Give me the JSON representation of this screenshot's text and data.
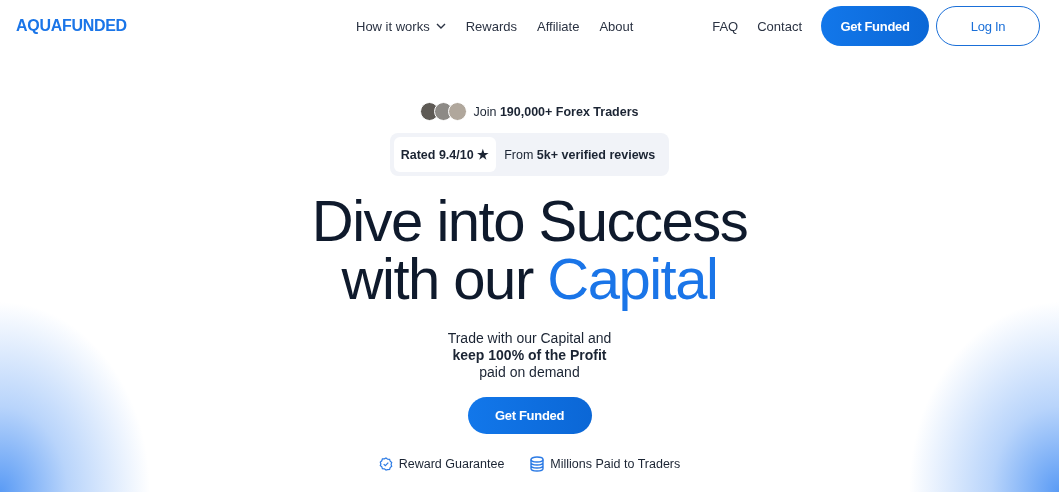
{
  "header": {
    "logo": "AQUAFUNDED",
    "nav": [
      {
        "label": "How it works",
        "kind": "dropdown"
      },
      {
        "label": "Rewards",
        "kind": "link"
      },
      {
        "label": "Affiliate",
        "kind": "link"
      },
      {
        "label": "About",
        "kind": "link"
      }
    ],
    "secondary_nav": [
      "FAQ",
      "Contact"
    ],
    "buttons": [
      {
        "label": "Get Funded",
        "kind": "primary"
      },
      {
        "label": "Log In",
        "kind": "outline"
      }
    ]
  },
  "hero": {
    "social_proof": "Join **190,000+ Forex Traders**",
    "rating": "Rated 9.4/10 ★",
    "reviews": "From **5k+ verified reviews**",
    "headline_line1": "Dive into Success",
    "headline_line2": "with our",
    "headline_highlight": "Capital",
    "subtitle_lines": [
      "Trade with our Capital and",
      "**keep 100% of the Profit**",
      "paid on demand"
    ],
    "cta": "Get Funded",
    "features": [
      {
        "label": "Reward Guarantee",
        "kind": "badge"
      },
      {
        "label": "Millions Paid to Traders",
        "kind": "database"
      }
    ]
  }
}
